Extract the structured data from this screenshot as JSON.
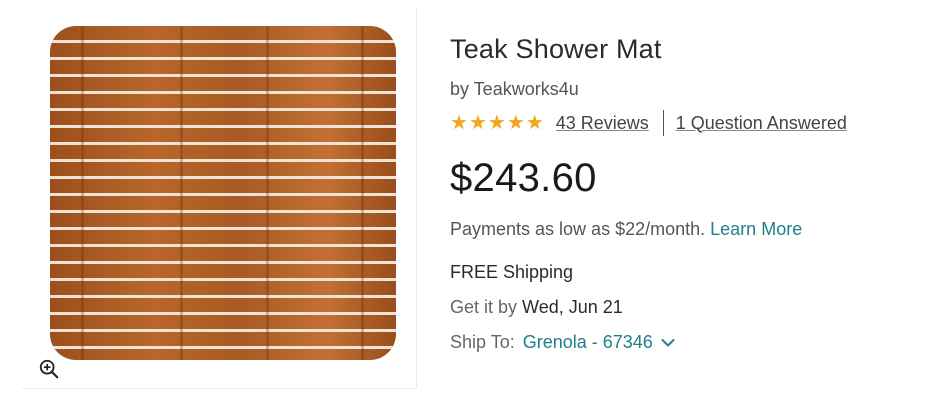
{
  "product": {
    "image": {
      "label": "teak shower mat photo",
      "icon": "zoom-in-icon"
    },
    "title": "Teak Shower Mat",
    "brand": "by Teakworks4u",
    "rating": {
      "stars": 5,
      "reviews_label": "43 Reviews",
      "questions_label": "1 Question Answered"
    },
    "price": "$243.60",
    "payments": {
      "text": "Payments as low as $22/month.",
      "link": "Learn More"
    },
    "shipping": "FREE Shipping",
    "delivery": {
      "label": "Get it by",
      "date": "Wed, Jun 21"
    },
    "ship_to": {
      "label": "Ship To:",
      "location": "Grenola - 67346",
      "icon": "chevron-down-icon"
    }
  },
  "colors": {
    "star": "#f4a51c",
    "link_teal": "#1f7f8a",
    "teak": "#b8662a"
  }
}
